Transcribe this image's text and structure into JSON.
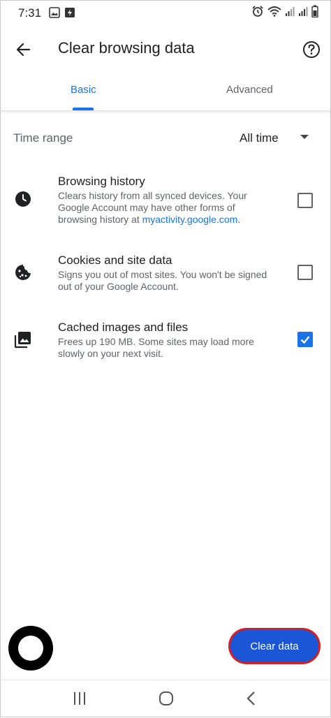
{
  "status_bar": {
    "time": "7:31",
    "left_icons": [
      "image-notification-icon",
      "lightning-app-icon"
    ],
    "right_icons": [
      "alarm-icon",
      "wifi-icon",
      "signal-icon",
      "signal-icon-2",
      "battery-icon"
    ]
  },
  "app_bar": {
    "title": "Clear browsing data",
    "back_icon": "back-arrow-icon",
    "help_icon": "help-icon"
  },
  "tabs": [
    {
      "label": "Basic",
      "selected": true
    },
    {
      "label": "Advanced",
      "selected": false
    }
  ],
  "time_range": {
    "label": "Time range",
    "value": "All time"
  },
  "items": [
    {
      "title": "Browsing history",
      "desc_before_link": "Clears history from all synced devices. Your Google Account may have other forms of browsing history at ",
      "link": "myactivity.google.com",
      "desc_after_link": ".",
      "checked": false,
      "icon": "clock-icon"
    },
    {
      "title": "Cookies and site data",
      "desc": "Signs you out of most sites. You won't be signed out of your Google Account.",
      "checked": false,
      "icon": "cookie-icon"
    },
    {
      "title": "Cached images and files",
      "desc": "Frees up 190 MB. Some sites may load more slowly on your next visit.",
      "checked": true,
      "icon": "images-icon"
    }
  ],
  "clear_button": {
    "label": "Clear data"
  },
  "colors": {
    "accent": "#1a73e8",
    "button": "#1a56d6",
    "highlight_ring": "#d32026"
  },
  "nav_bar": {
    "icons": [
      "recents-icon",
      "home-icon",
      "back-icon"
    ]
  }
}
